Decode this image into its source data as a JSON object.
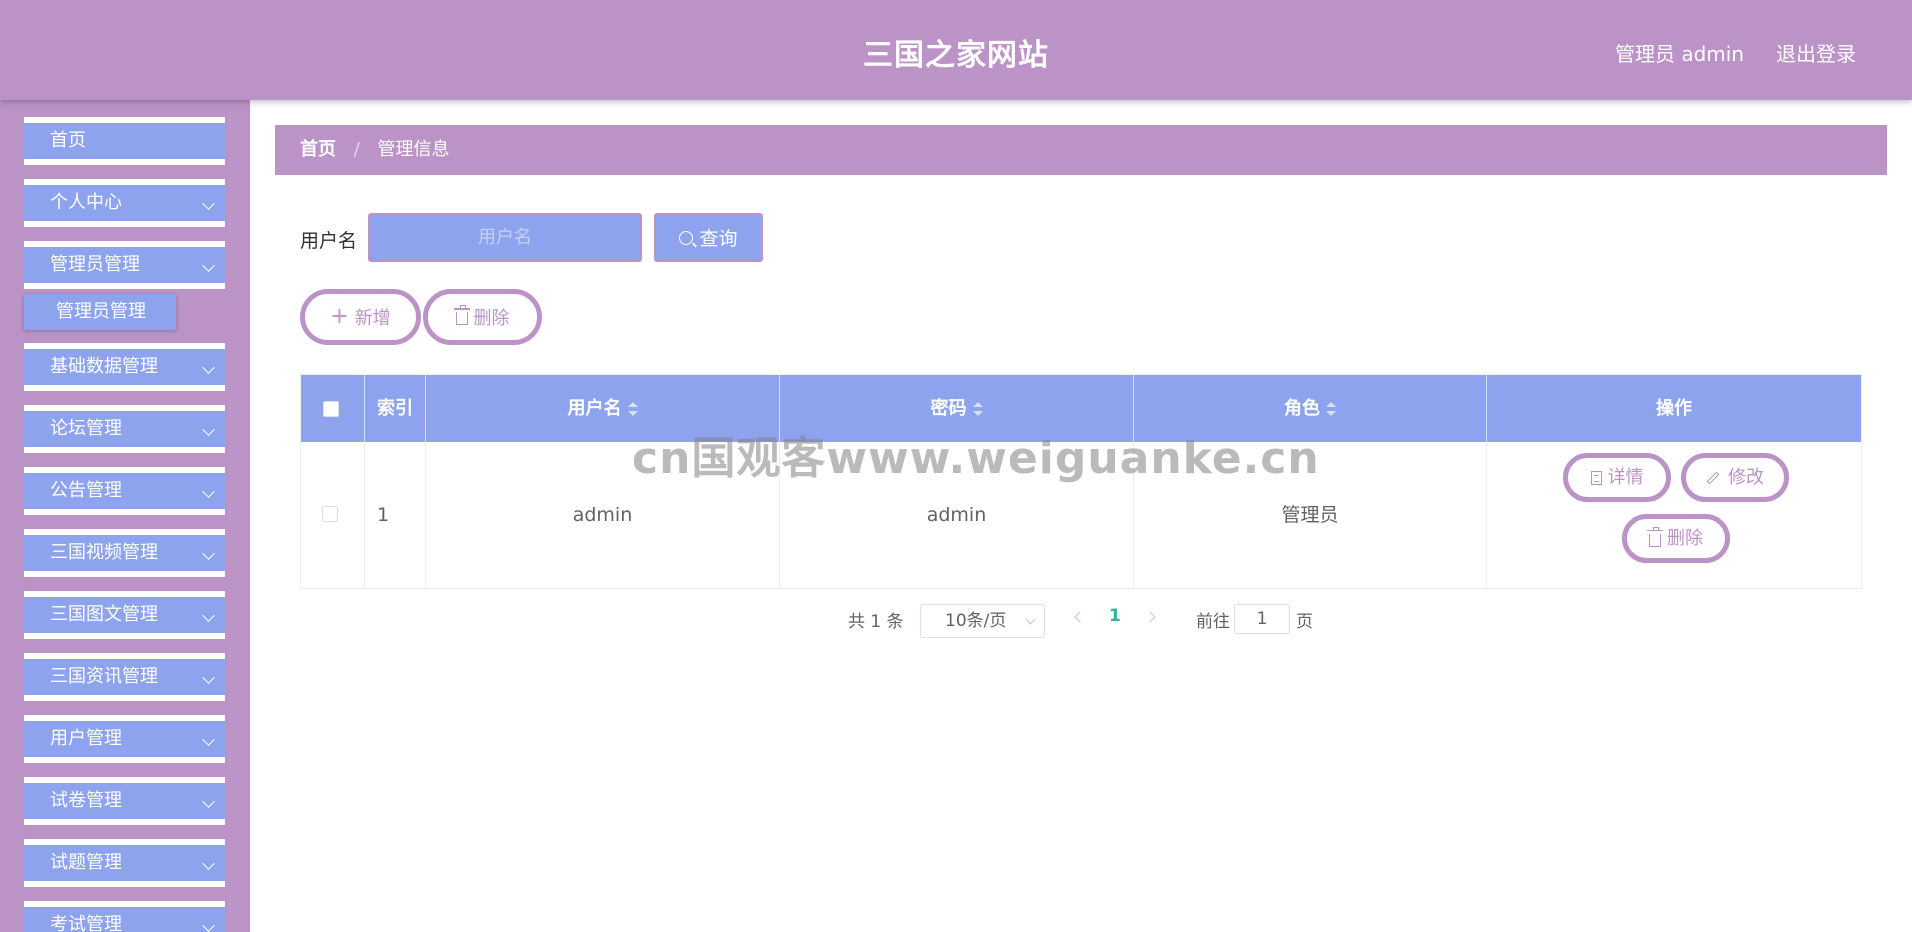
{
  "header": {
    "title": "三国之家网站",
    "user": "管理员 admin",
    "logout": "退出登录"
  },
  "sidebar": {
    "items": [
      {
        "label": "首页",
        "has_arrow": false
      },
      {
        "label": "个人中心",
        "has_arrow": true
      },
      {
        "label": "管理员管理",
        "has_arrow": true
      },
      {
        "label": "基础数据管理",
        "has_arrow": true
      },
      {
        "label": "论坛管理",
        "has_arrow": true
      },
      {
        "label": "公告管理",
        "has_arrow": true
      },
      {
        "label": "三国视频管理",
        "has_arrow": true
      },
      {
        "label": "三国图文管理",
        "has_arrow": true
      },
      {
        "label": "三国资讯管理",
        "has_arrow": true
      },
      {
        "label": "用户管理",
        "has_arrow": true
      },
      {
        "label": "试卷管理",
        "has_arrow": true
      },
      {
        "label": "试题管理",
        "has_arrow": true
      },
      {
        "label": "考试管理",
        "has_arrow": true
      }
    ],
    "submenu": {
      "label": "管理员管理"
    }
  },
  "breadcrumb": {
    "home": "首页",
    "separator": "/",
    "current": "管理信息"
  },
  "search": {
    "label": "用户名",
    "placeholder": "用户名",
    "value": "",
    "button": "查询"
  },
  "actions": {
    "add": "新增",
    "delete": "删除"
  },
  "table": {
    "columns": {
      "index": "索引",
      "username": "用户名",
      "password": "密码",
      "role": "角色",
      "operation": "操作"
    },
    "rows": [
      {
        "index": "1",
        "username": "admin",
        "password": "admin",
        "role": "管理员"
      }
    ],
    "row_actions": {
      "detail": "详情",
      "edit": "修改",
      "delete": "删除"
    }
  },
  "pagination": {
    "total": "共 1 条",
    "page_size": "10条/页",
    "current_page": "1",
    "goto_label": "前往",
    "goto_value": "1",
    "goto_unit": "页"
  },
  "watermark": "cn国观客www.weiguanke.cn",
  "colors": {
    "primary": "#bc93c7",
    "accent": "#8ea3ee",
    "current_page": "#2fb29a"
  }
}
